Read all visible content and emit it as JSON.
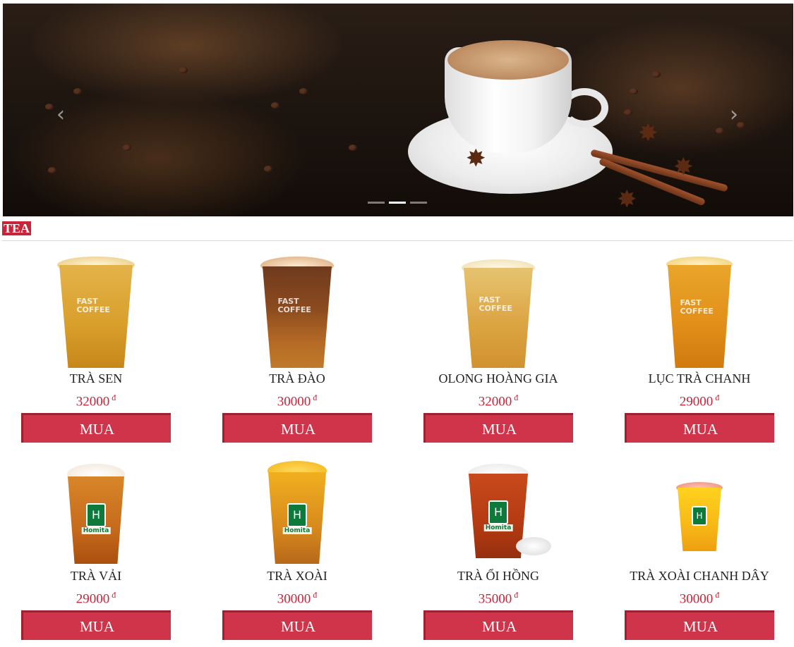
{
  "slider": {
    "prev_icon": "chevron-left-icon",
    "next_icon": "chevron-right-icon",
    "prev_glyph": "‹",
    "next_glyph": "›",
    "slide_count": 3,
    "active_slide": 2
  },
  "section": {
    "title": "TEA"
  },
  "colors": {
    "accent": "#c8243a",
    "button": "#d0344a",
    "tea": "#e0a530",
    "peach": "#6e3a1d",
    "mango": "#f0b020"
  },
  "products": [
    {
      "name": "TRÀ SEN",
      "price": "32000",
      "currency": "đ",
      "buy_label": "MUA"
    },
    {
      "name": "TRÀ ĐÀO",
      "price": "30000",
      "currency": "đ",
      "buy_label": "MUA"
    },
    {
      "name": "OLONG HOÀNG GIA",
      "price": "32000",
      "currency": "đ",
      "buy_label": "MUA"
    },
    {
      "name": "LỤC TRÀ CHANH",
      "price": "29000",
      "currency": "đ",
      "buy_label": "MUA"
    },
    {
      "name": "TRÀ VẢI",
      "price": "29000",
      "currency": "đ",
      "buy_label": "MUA"
    },
    {
      "name": "TRÀ XOÀI",
      "price": "30000",
      "currency": "đ",
      "buy_label": "MUA"
    },
    {
      "name": "TRÀ ỔI HỒNG",
      "price": "35000",
      "currency": "đ",
      "buy_label": "MUA"
    },
    {
      "name": "TRÀ XOÀI CHANH DÂY",
      "price": "30000",
      "currency": "đ",
      "buy_label": "MUA"
    }
  ],
  "cup_branding": {
    "row1": "FAST\nCOFFEE",
    "row2_logo": "H",
    "row2_text": "Homita"
  }
}
